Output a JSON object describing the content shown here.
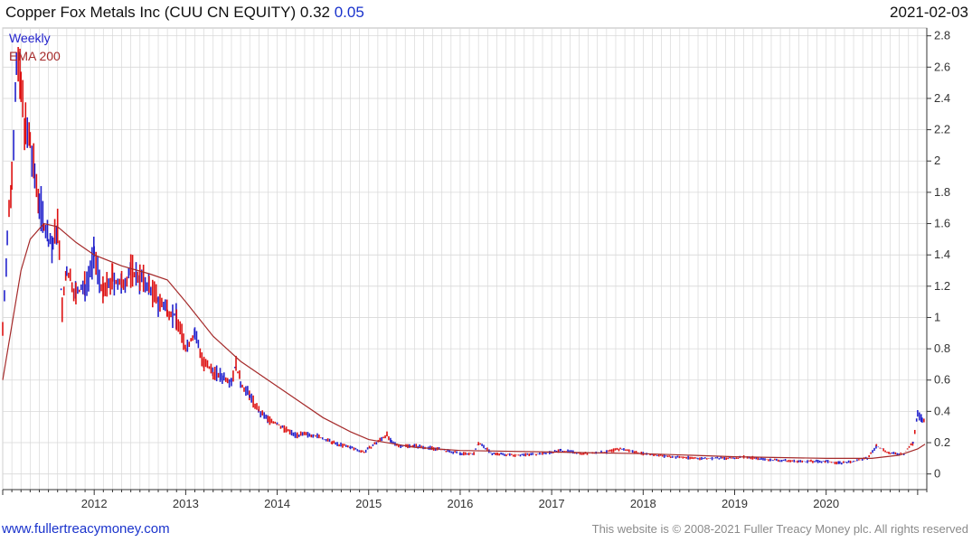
{
  "header": {
    "title": "Copper Fox Metals Inc (CUU CN EQUITY) 0.32",
    "change": "0.05",
    "date": "2021-02-03"
  },
  "footer": {
    "site": "www.fullertreacymoney.com",
    "copyright": "This website is © 2008-2021 Fuller Treacy Money plc. All rights reserved"
  },
  "colors": {
    "up_bar": "#2222cc",
    "down_bar": "#dd1111",
    "ema": "#a52a2a",
    "grid": "#d8d8d8",
    "axis": "#333333"
  },
  "chart_data": {
    "type": "line",
    "legend": [
      "Weekly",
      "EMA 200"
    ],
    "legend_position": "top-left",
    "grid": true,
    "y_axis_side": "right",
    "ylim": [
      -0.1,
      2.85
    ],
    "y_ticks": [
      0,
      0.2,
      0.4,
      0.6,
      0.8,
      1,
      1.2,
      1.4,
      1.6,
      1.8,
      2,
      2.2,
      2.4,
      2.6,
      2.8
    ],
    "y_tick_labels": [
      "0",
      "0.2",
      "0.4",
      "0.6",
      "0.8",
      "1",
      "1.2",
      "1.4",
      "1.6",
      "1.8",
      "2",
      "2.2",
      "2.4",
      "2.6",
      "2.8"
    ],
    "xlim": [
      2011.0,
      2021.1
    ],
    "x_tick_labels": [
      "2012",
      "2013",
      "2014",
      "2015",
      "2016",
      "2017",
      "2018",
      "2019",
      "2020"
    ],
    "x_ticks": [
      2012,
      2013,
      2014,
      2015,
      2016,
      2017,
      2018,
      2019,
      2020
    ],
    "series": [
      {
        "name": "Weekly",
        "x": [
          2011.0,
          2011.05,
          2011.1,
          2011.15,
          2011.2,
          2011.25,
          2011.3,
          2011.35,
          2011.4,
          2011.45,
          2011.5,
          2011.55,
          2011.6,
          2011.65,
          2011.7,
          2011.8,
          2011.9,
          2012.0,
          2012.1,
          2012.2,
          2012.3,
          2012.4,
          2012.5,
          2012.6,
          2012.7,
          2012.8,
          2012.9,
          2013.0,
          2013.1,
          2013.2,
          2013.3,
          2013.4,
          2013.5,
          2013.55,
          2013.6,
          2013.7,
          2013.8,
          2013.9,
          2014.0,
          2014.1,
          2014.2,
          2014.4,
          2014.6,
          2014.8,
          2014.95,
          2015.2,
          2015.25,
          2015.35,
          2015.5,
          2015.75,
          2016.0,
          2016.15,
          2016.2,
          2016.35,
          2016.6,
          2016.9,
          2017.1,
          2017.35,
          2017.6,
          2017.75,
          2018.0,
          2018.3,
          2018.6,
          2019.0,
          2019.1,
          2019.4,
          2019.7,
          2020.0,
          2020.15,
          2020.3,
          2020.45,
          2020.55,
          2020.7,
          2020.85,
          2020.95,
          2021.0,
          2021.05,
          2021.08
        ],
        "y": [
          0.93,
          1.5,
          1.9,
          2.65,
          2.45,
          2.2,
          2.1,
          1.9,
          1.75,
          1.6,
          1.5,
          1.45,
          1.6,
          1.05,
          1.3,
          1.15,
          1.2,
          1.4,
          1.15,
          1.25,
          1.2,
          1.3,
          1.25,
          1.2,
          1.1,
          1.05,
          1.0,
          0.8,
          0.9,
          0.7,
          0.65,
          0.62,
          0.6,
          0.7,
          0.58,
          0.5,
          0.4,
          0.35,
          0.32,
          0.28,
          0.25,
          0.25,
          0.2,
          0.17,
          0.14,
          0.25,
          0.2,
          0.18,
          0.18,
          0.16,
          0.13,
          0.13,
          0.2,
          0.13,
          0.12,
          0.13,
          0.15,
          0.13,
          0.14,
          0.16,
          0.13,
          0.11,
          0.1,
          0.1,
          0.11,
          0.09,
          0.08,
          0.08,
          0.07,
          0.08,
          0.1,
          0.18,
          0.13,
          0.13,
          0.2,
          0.38,
          0.35,
          0.32
        ]
      },
      {
        "name": "EMA 200",
        "x": [
          2011.0,
          2011.1,
          2011.2,
          2011.3,
          2011.45,
          2011.6,
          2011.8,
          2012.0,
          2012.3,
          2012.6,
          2012.8,
          2013.0,
          2013.3,
          2013.6,
          2013.9,
          2014.2,
          2014.5,
          2014.8,
          2015.0,
          2015.5,
          2016.0,
          2017.0,
          2018.0,
          2019.0,
          2020.0,
          2020.5,
          2020.8,
          2021.0,
          2021.08
        ],
        "y": [
          0.6,
          0.95,
          1.3,
          1.5,
          1.6,
          1.58,
          1.48,
          1.4,
          1.33,
          1.28,
          1.24,
          1.1,
          0.88,
          0.72,
          0.6,
          0.48,
          0.36,
          0.27,
          0.22,
          0.17,
          0.15,
          0.14,
          0.13,
          0.11,
          0.1,
          0.1,
          0.12,
          0.16,
          0.19
        ]
      }
    ]
  }
}
